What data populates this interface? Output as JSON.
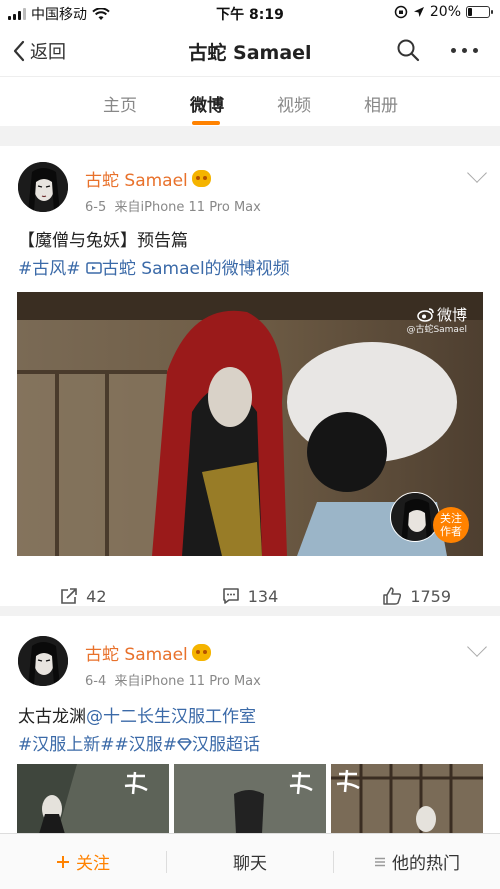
{
  "status_bar": {
    "carrier": "中国移动",
    "time": "下午 8:19",
    "battery": "20%",
    "battery_level": 0.2
  },
  "nav": {
    "back_label": "返回",
    "title": "古蛇 Samael"
  },
  "tabs": [
    {
      "label": "主页"
    },
    {
      "label": "微博"
    },
    {
      "label": "视频"
    },
    {
      "label": "相册"
    }
  ],
  "posts": [
    {
      "user": "古蛇 Samael",
      "date": "6-5",
      "source": "来自iPhone 11 Pro Max",
      "title": "【魔僧与兔妖】预告篇",
      "tag": "#古风#",
      "video_link": "古蛇 Samael的微博视频",
      "watermark": "微博",
      "watermark_handle": "@古蛇Samael",
      "follow_badge_line1": "关注",
      "follow_badge_line2": "作者",
      "shares": "42",
      "comments": "134",
      "likes": "1759"
    },
    {
      "user": "古蛇 Samael",
      "date": "6-4",
      "source": "来自iPhone 11 Pro Max",
      "text_plain": "太古龙渊",
      "mention": "@十二长生汉服工作室",
      "tags": "#汉服上新##汉服#",
      "super_topic": "汉服超话"
    }
  ],
  "bottom_bar": {
    "follow": "关注",
    "chat": "聊天",
    "hot": "他的热门"
  },
  "colors": {
    "accent": "#ff8200",
    "username": "#e8712b",
    "link": "#3b6aa8"
  }
}
